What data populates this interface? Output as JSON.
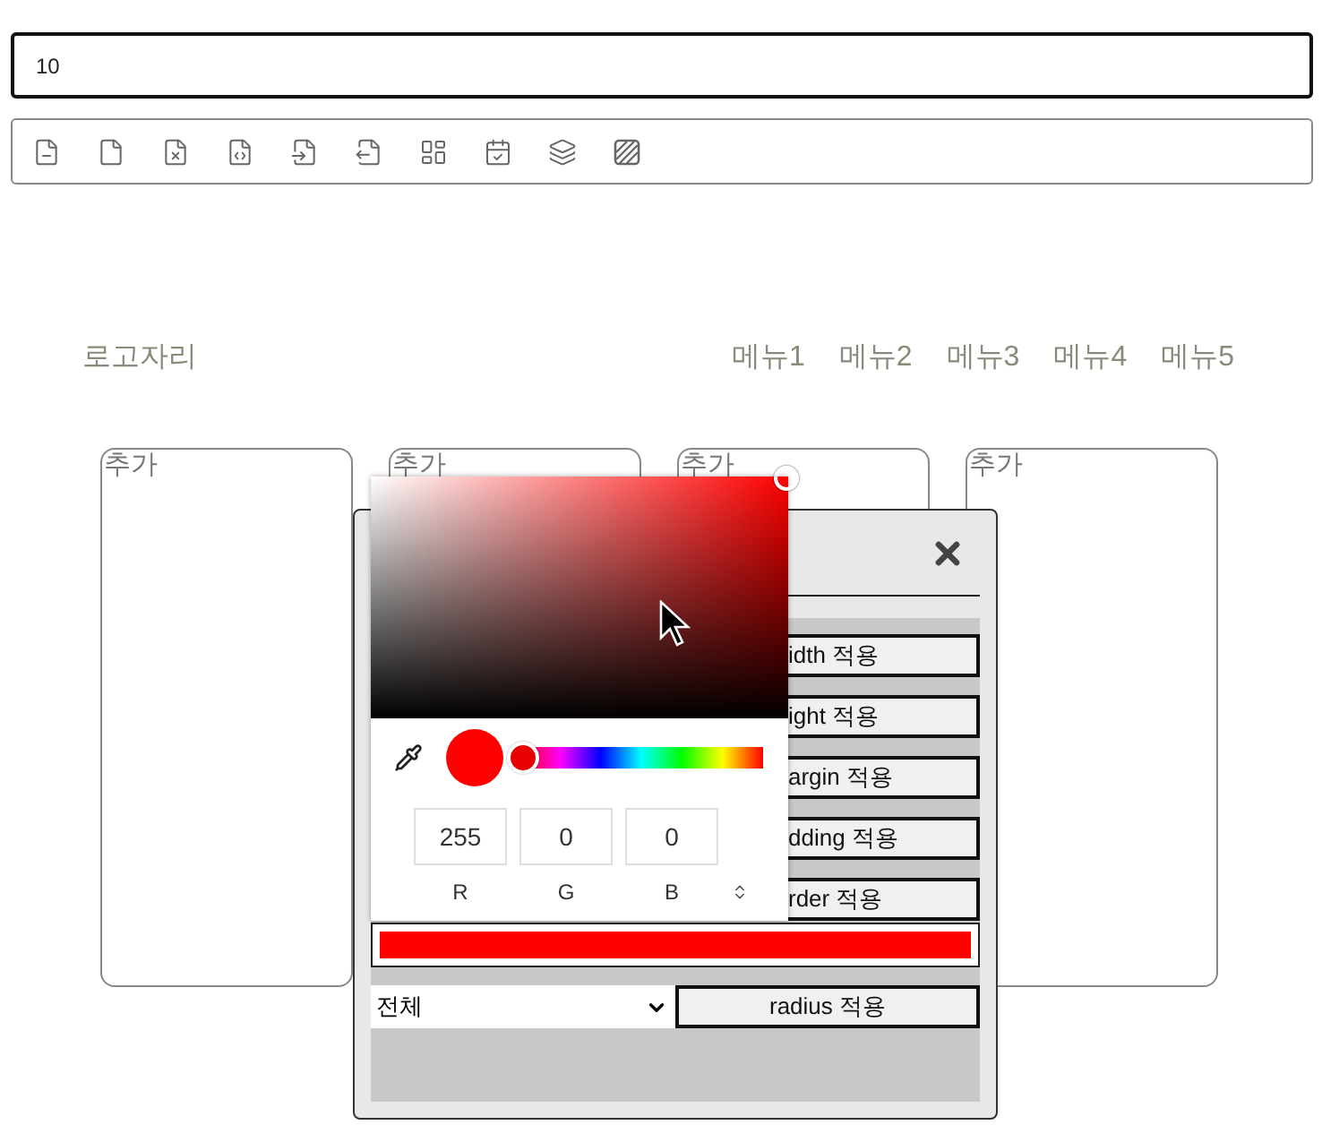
{
  "address_field": {
    "value": "10"
  },
  "header": {
    "logo": "로고자리",
    "menu": [
      "메뉴1",
      "메뉴2",
      "메뉴3",
      "메뉴4",
      "메뉴5"
    ]
  },
  "cards": [
    {
      "label": "추가"
    },
    {
      "label": "추가"
    },
    {
      "label": "추가"
    },
    {
      "label": "추가"
    }
  ],
  "modal": {
    "buttons": [
      "idth 적용",
      "ight 적용",
      "argin 적용",
      "dding 적용",
      "rder 적용"
    ],
    "select": {
      "value": "전체"
    },
    "radius_button": "radius 적용"
  },
  "picker": {
    "hue": {
      "level": 0
    },
    "channels": [
      {
        "label": "R",
        "value": "255"
      },
      {
        "label": "G",
        "value": "0"
      },
      {
        "label": "B",
        "value": "0"
      }
    ]
  }
}
